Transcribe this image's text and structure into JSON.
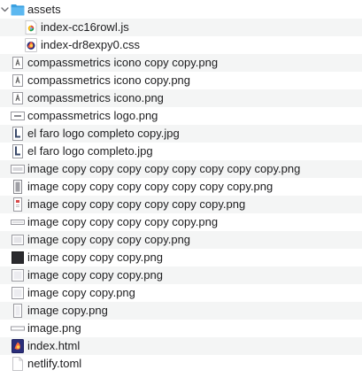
{
  "files": [
    {
      "name": "assets",
      "icon": "folder-icon",
      "level": 0,
      "expanded": true
    },
    {
      "name": "index-cc16rowl.js",
      "icon": "js-file-icon",
      "level": 1
    },
    {
      "name": "index-dr8expy0.css",
      "icon": "css-file-icon",
      "level": 1
    },
    {
      "name": "compassmetrics icono copy copy.png",
      "icon": "image-thumb-icon",
      "level": 0
    },
    {
      "name": "compassmetrics icono copy.png",
      "icon": "image-thumb-icon",
      "level": 0
    },
    {
      "name": "compassmetrics icono.png",
      "icon": "image-thumb-icon",
      "level": 0
    },
    {
      "name": "compassmetrics logo.png",
      "icon": "image-wide-icon",
      "level": 0
    },
    {
      "name": "el faro logo completo copy.jpg",
      "icon": "image-tall-icon",
      "level": 0
    },
    {
      "name": "el faro logo completo.jpg",
      "icon": "image-tall-icon",
      "level": 0
    },
    {
      "name": "image copy copy copy copy copy copy copy copy.png",
      "icon": "image-wide-icon",
      "level": 0
    },
    {
      "name": "image copy copy copy copy copy copy copy.png",
      "icon": "image-narrow-icon",
      "level": 0
    },
    {
      "name": "image copy copy copy copy copy copy.png",
      "icon": "image-narrow-red-icon",
      "level": 0
    },
    {
      "name": "image copy copy copy copy copy.png",
      "icon": "image-strip-icon",
      "level": 0
    },
    {
      "name": "image copy copy copy copy.png",
      "icon": "image-thumb-icon",
      "level": 0
    },
    {
      "name": "image copy copy copy.png",
      "icon": "image-dark-icon",
      "level": 0
    },
    {
      "name": "image copy copy copy.png",
      "icon": "image-thumb-icon",
      "level": 0
    },
    {
      "name": "image copy copy.png",
      "icon": "image-thumb-icon",
      "level": 0
    },
    {
      "name": "image copy.png",
      "icon": "image-narrow-icon",
      "level": 0
    },
    {
      "name": "image.png",
      "icon": "image-strip-icon",
      "level": 0
    },
    {
      "name": "index.html",
      "icon": "html-file-icon",
      "level": 0
    },
    {
      "name": "netlify.toml",
      "icon": "document-icon",
      "level": 0
    }
  ]
}
